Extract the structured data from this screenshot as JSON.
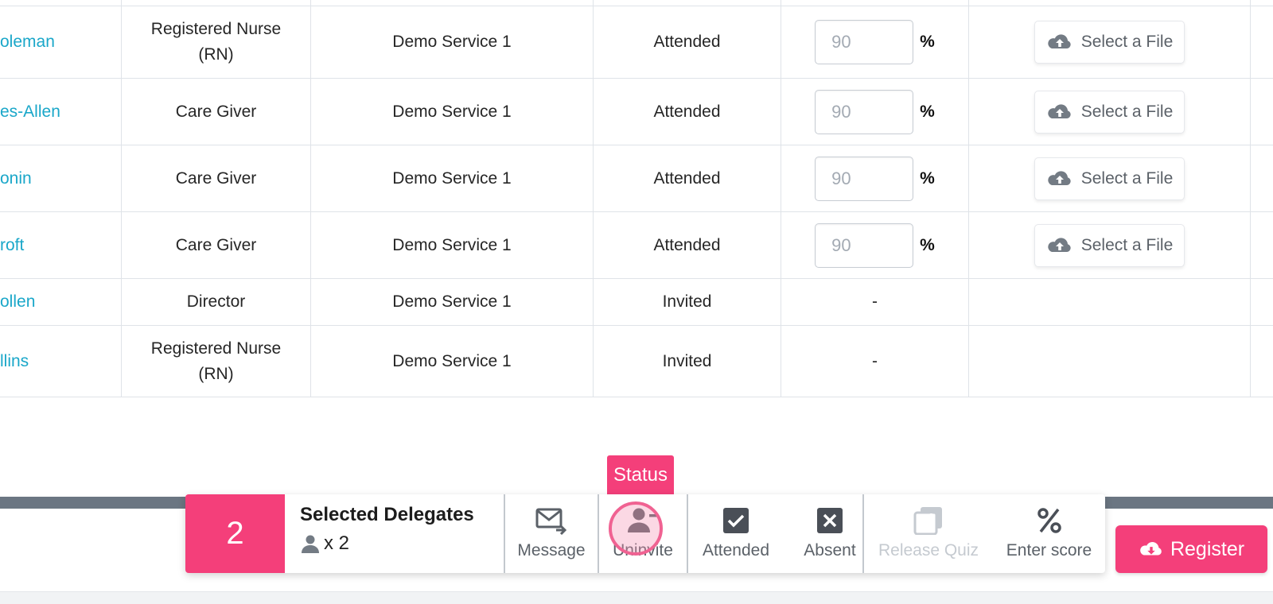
{
  "table": {
    "rows": [
      {
        "name": "oleman",
        "role": "Registered Nurse (RN)",
        "service": "Demo Service 1",
        "status": "Attended",
        "score_placeholder": "90",
        "score_unit": "%",
        "file_label": "Select a File"
      },
      {
        "name": "es-Allen",
        "role": "Care Giver",
        "service": "Demo Service 1",
        "status": "Attended",
        "score_placeholder": "90",
        "score_unit": "%",
        "file_label": "Select a File"
      },
      {
        "name": "onin",
        "role": "Care Giver",
        "service": "Demo Service 1",
        "status": "Attended",
        "score_placeholder": "90",
        "score_unit": "%",
        "file_label": "Select a File"
      },
      {
        "name": "roft",
        "role": "Care Giver",
        "service": "Demo Service 1",
        "status": "Attended",
        "score_placeholder": "90",
        "score_unit": "%",
        "file_label": "Select a File"
      },
      {
        "name": "ollen",
        "role": "Director",
        "service": "Demo Service 1",
        "status": "Invited",
        "score_text": "-"
      },
      {
        "name": "llins",
        "role": "Registered Nurse (RN)",
        "service": "Demo Service 1",
        "status": "Invited",
        "score_text": "-"
      }
    ]
  },
  "action_bar": {
    "selected_count": "2",
    "title": "Selected Delegates",
    "person_count": "x 2",
    "tooltip": "Status",
    "actions": [
      {
        "label": "Message",
        "icon": "message-send-icon",
        "enabled": true
      },
      {
        "label": "Uninvite",
        "icon": "user-minus-icon",
        "enabled": true
      },
      {
        "label": "Attended",
        "icon": "check-square-icon",
        "enabled": true
      },
      {
        "label": "Absent",
        "icon": "x-square-icon",
        "enabled": true
      },
      {
        "label": "Release Quiz",
        "icon": "quiz-icon",
        "enabled": false
      },
      {
        "label": "Enter score",
        "icon": "percent-icon",
        "enabled": true
      }
    ],
    "register_label": "Register"
  },
  "colors": {
    "accent": "#f43f7a",
    "link": "#1aa7c9",
    "icon": "#5b6168"
  }
}
